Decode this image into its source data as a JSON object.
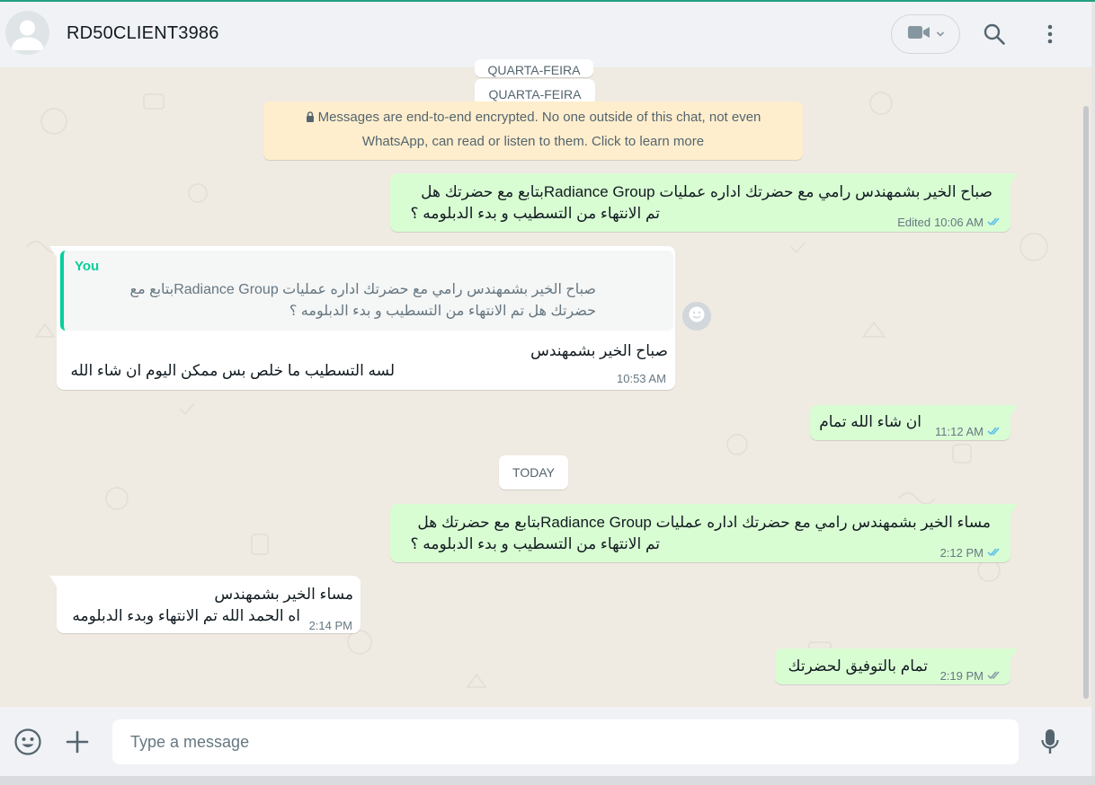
{
  "header": {
    "contact_name": "RD50CLIENT3986"
  },
  "chat": {
    "date_top_partial": "QUARTA-FEIRA",
    "date_wednesday": "QUARTA-FEIRA",
    "encryption_line1": "Messages are end-to-end encrypted. No one outside of this chat, not even",
    "encryption_line2": "WhatsApp, can read or listen to them. Click to learn more",
    "date_today": "TODAY",
    "messages": [
      {
        "direction": "outgoing",
        "lines": [
          "صباح الخير بشمهندس رامي مع  حضرتك اداره عمليات Radiance Groupبتابع مع حضرتك هل",
          "تم الانتهاء من التسطيب و بدء الدبلومه ؟"
        ],
        "edited": "Edited",
        "time": "10:06 AM",
        "status": "read"
      },
      {
        "direction": "incoming",
        "quote_sender": "You",
        "quote_lines": [
          "صباح الخير بشمهندس رامي مع  حضرتك اداره عمليات Radiance Groupبتابع مع",
          "حضرتك هل تم الانتهاء من التسطيب و بدء الدبلومه ؟"
        ],
        "lines": [
          "صباح الخير بشمهندس",
          "لسه التسطيب ما خلص بس ممكن اليوم ان شاء الله"
        ],
        "time": "10:53 AM"
      },
      {
        "direction": "outgoing",
        "lines": [
          "ان شاء الله تمام"
        ],
        "time": "11:12 AM",
        "status": "read"
      },
      {
        "direction": "outgoing",
        "lines": [
          "مساء الخير بشمهندس رامي مع  حضرتك اداره عمليات Radiance Groupبتابع مع حضرتك هل",
          "تم الانتهاء من التسطيب و بدء الدبلومه ؟"
        ],
        "time": "2:12 PM",
        "status": "read"
      },
      {
        "direction": "incoming",
        "lines": [
          "مساء الخير بشمهندس",
          "اه الحمد الله تم الانتهاء وبدء الدبلومه"
        ],
        "time": "2:14 PM"
      },
      {
        "direction": "outgoing",
        "lines": [
          "تمام بالتوفيق لحضرتك"
        ],
        "time": "2:19 PM",
        "status": "delivered"
      }
    ]
  },
  "composer": {
    "placeholder": "Type a message"
  },
  "colors": {
    "outgoing_bubble": "#d9fdd3",
    "incoming_bubble": "#ffffff",
    "read_ticks": "#53bdeb",
    "quote_accent": "#06cf9c",
    "encryption_notice": "#ffeecd"
  }
}
